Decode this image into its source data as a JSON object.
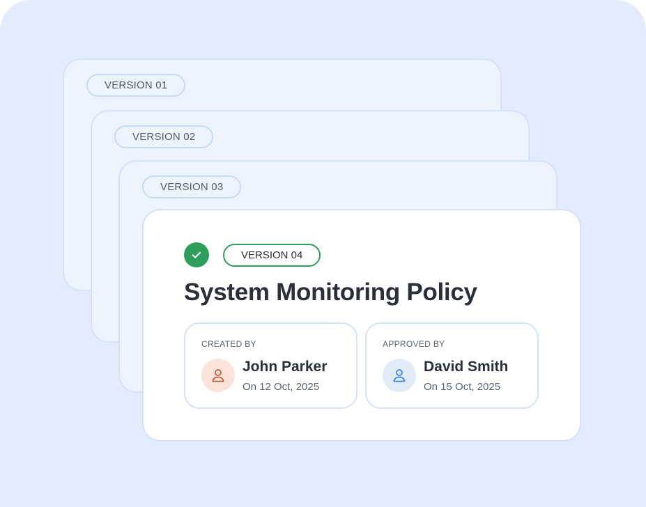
{
  "versions": [
    {
      "label": "VERSION 01"
    },
    {
      "label": "VERSION 02"
    },
    {
      "label": "VERSION 03"
    }
  ],
  "current": {
    "version_label": "VERSION 04",
    "status_icon": "check-icon",
    "title": "System Monitoring Policy",
    "created": {
      "label": "CREATED BY",
      "name": "John Parker",
      "date": "On 12 Oct, 2025",
      "avatar_icon": "user-icon",
      "avatar_color": "#c0603a"
    },
    "approved": {
      "label": "APPROVED BY",
      "name": "David Smith",
      "date": "On 15 Oct, 2025",
      "avatar_icon": "user-icon",
      "avatar_color": "#3a86e8"
    }
  },
  "colors": {
    "background": "#e3ecfd",
    "success": "#2f9e5d",
    "text": "#2b2f3a"
  }
}
